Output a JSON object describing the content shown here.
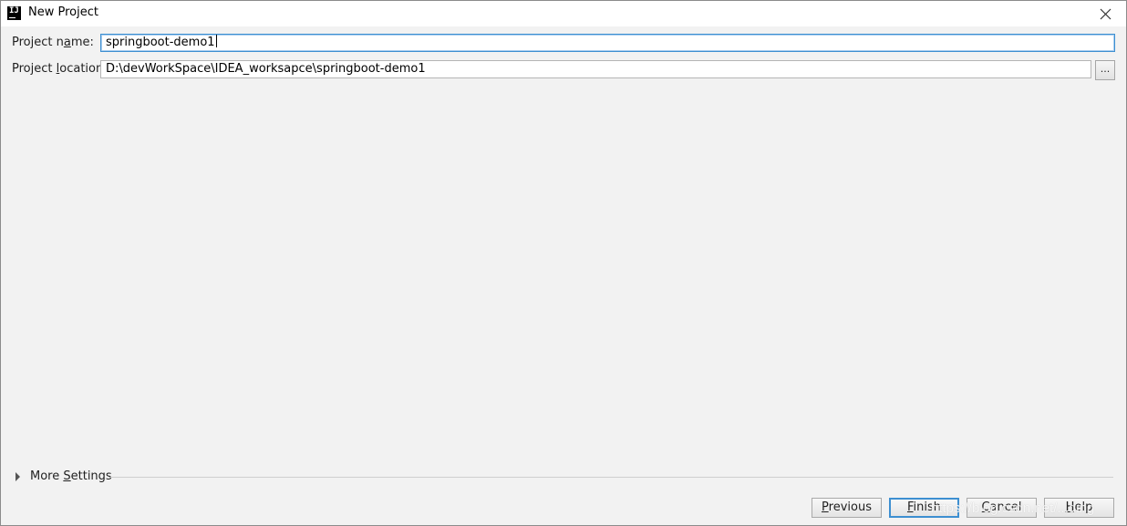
{
  "window": {
    "title": "New Project",
    "icon": "intellij-idea-icon"
  },
  "form": {
    "name_label_pre": "Project n",
    "name_label_mn": "a",
    "name_label_post": "me:",
    "name_value": "springboot-demo1",
    "location_label_pre": "Project ",
    "location_label_mn": "l",
    "location_label_post": "ocation:",
    "location_value": "D:\\devWorkSpace\\IDEA_worksapce\\springboot-demo1",
    "browse_label": "..."
  },
  "more_settings": {
    "label_pre": "More ",
    "label_mn": "S",
    "label_post": "ettings"
  },
  "buttons": {
    "previous": {
      "mn": "P",
      "rest": "revious"
    },
    "finish": {
      "mn": "F",
      "rest": "inish"
    },
    "cancel": {
      "mn": "C",
      "rest": "ancel"
    },
    "help": {
      "mn": "H",
      "rest": "elp"
    }
  },
  "watermark": "https://blog.csdn.net/...ding",
  "colors": {
    "background": "#f2f2f2",
    "focus_border": "#3d8fd1"
  }
}
